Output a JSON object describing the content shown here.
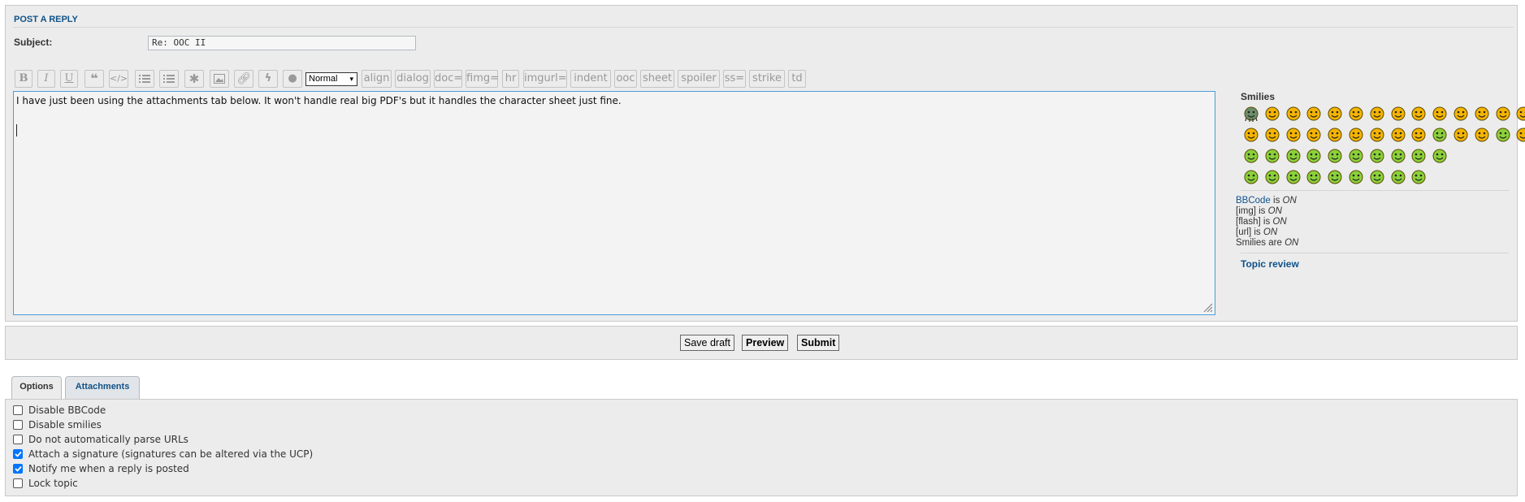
{
  "post": {
    "title": "POST A REPLY",
    "subject_label": "Subject:",
    "subject_value": "Re: OOC II",
    "font_size_select": "Normal",
    "message": "I have just been using the attachments tab below.  It won't handle real big PDF's but it handles the character sheet just fine."
  },
  "toolbar": {
    "icon_buttons": [
      "bold-icon",
      "italic-icon",
      "underline-icon",
      "quote-icon",
      "code-icon",
      "list-icon",
      "numbered-list-icon",
      "list-item-icon",
      "image-icon",
      "link-icon",
      "flash-icon",
      "color-icon"
    ],
    "text_buttons": [
      "align",
      "dialog",
      "doc=",
      "fimg=",
      "hr",
      "imgurl=",
      "indent",
      "ooc",
      "sheet",
      "spoiler",
      "ss=",
      "strike",
      "td"
    ]
  },
  "sidebar": {
    "smilies_title": "Smilies",
    "bbcode_link": "BBCode",
    "status_lines": [
      {
        "prefix": "",
        "label": "BBCode",
        "middle": " is ",
        "value": "ON"
      },
      {
        "prefix": "[img]",
        "middle": " is ",
        "value": "ON"
      },
      {
        "prefix": "[flash]",
        "middle": " is ",
        "value": "ON"
      },
      {
        "prefix": "[url]",
        "middle": " is ",
        "value": "ON"
      },
      {
        "prefix": "Smilies",
        "middle": " are ",
        "value": "ON"
      }
    ],
    "topic_review": "Topic review"
  },
  "buttons": {
    "save_draft": "Save draft",
    "preview": "Preview",
    "submit": "Submit"
  },
  "tabs": {
    "options": "Options",
    "attachments": "Attachments"
  },
  "options": [
    {
      "label": "Disable BBCode",
      "checked": false
    },
    {
      "label": "Disable smilies",
      "checked": false
    },
    {
      "label": "Do not automatically parse URLs",
      "checked": false
    },
    {
      "label": "Attach a signature (signatures can be altered via the UCP)",
      "checked": true
    },
    {
      "label": "Notify me when a reply is posted",
      "checked": true
    },
    {
      "label": "Lock topic",
      "checked": false
    }
  ],
  "colors": {
    "accent": "#105289",
    "panel_bg": "#ececec",
    "checkbox_checked": "#0075ff",
    "smiley_yellow": "#f5b400",
    "smiley_green": "#8ad13a"
  }
}
